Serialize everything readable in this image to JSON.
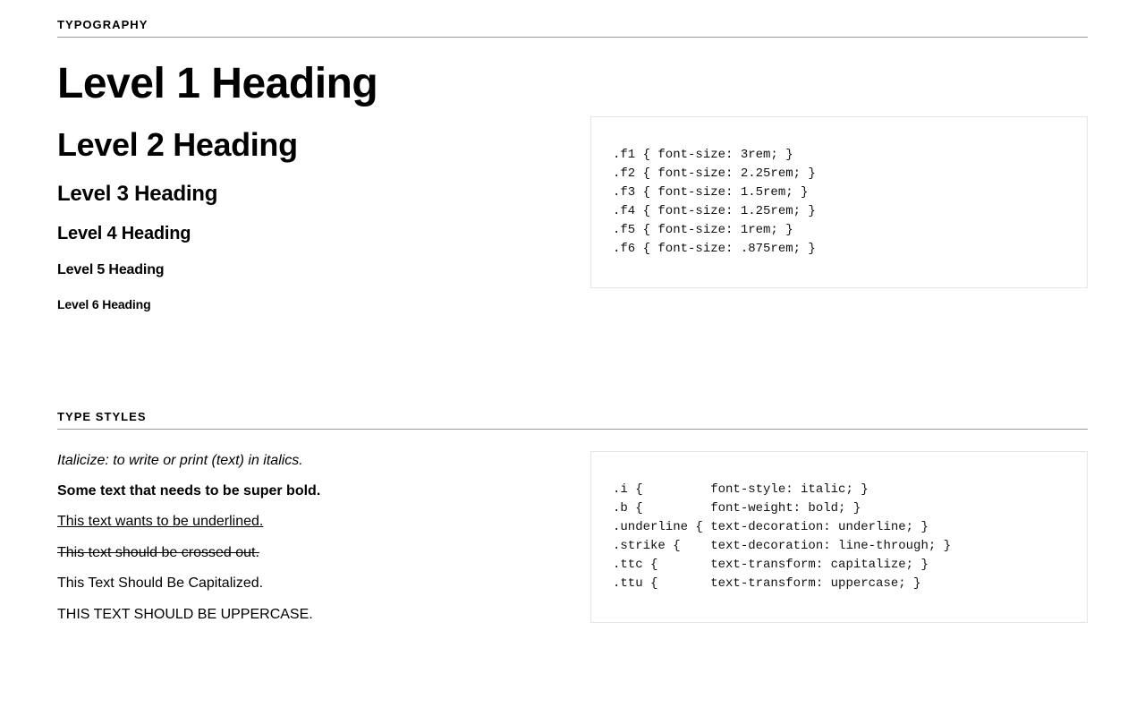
{
  "sections": {
    "typography": {
      "title": "Typography",
      "headings": {
        "h1": "Level 1 Heading",
        "h2": "Level 2 Heading",
        "h3": "Level 3 Heading",
        "h4": "Level 4 Heading",
        "h5": "Level 5 Heading",
        "h6": "Level 6 Heading"
      },
      "code": ".f1 { font-size: 3rem; }\n.f2 { font-size: 2.25rem; }\n.f3 { font-size: 1.5rem; }\n.f4 { font-size: 1.25rem; }\n.f5 { font-size: 1rem; }\n.f6 { font-size: .875rem; }"
    },
    "typeStyles": {
      "title": "Type Styles",
      "examples": {
        "italic": "Italicize: to write or print (text) in italics.",
        "bold": "Some text that needs to be super bold.",
        "underline": "This text wants to be underlined.",
        "strike": "This text should be crossed out.",
        "capitalize": "This Text Should Be Capitalized.",
        "uppercase": "this text should be uppercase."
      },
      "code": ".i {         font-style: italic; }\n.b {         font-weight: bold; }\n.underline { text-decoration: underline; }\n.strike {    text-decoration: line-through; }\n.ttc {       text-transform: capitalize; }\n.ttu {       text-transform: uppercase; }"
    }
  }
}
